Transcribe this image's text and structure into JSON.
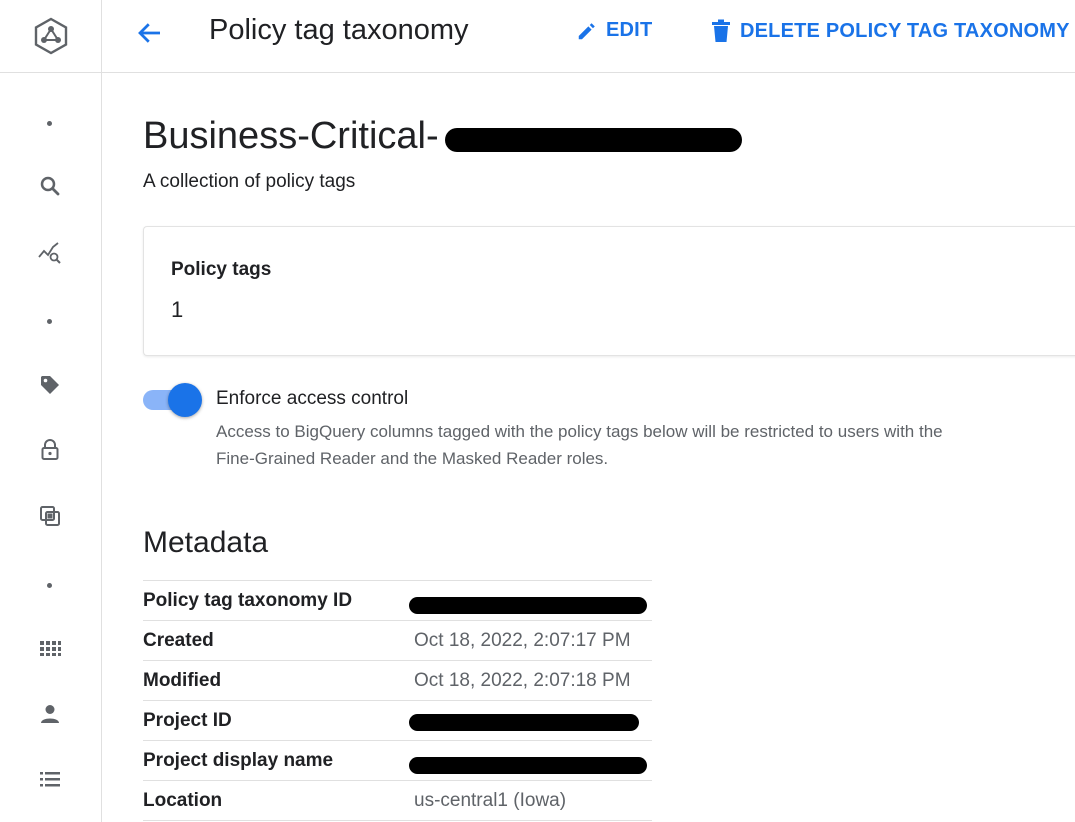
{
  "header": {
    "title": "Policy tag taxonomy",
    "edit_label": "EDIT",
    "delete_label": "DELETE POLICY TAG TAXONOMY"
  },
  "sidebar": {
    "items": [
      {
        "icon": "dot-icon"
      },
      {
        "icon": "search-icon"
      },
      {
        "icon": "insights-icon"
      },
      {
        "icon": "dot-icon"
      },
      {
        "icon": "tag-icon"
      },
      {
        "icon": "lock-icon"
      },
      {
        "icon": "filter-none-icon"
      },
      {
        "icon": "dot-icon"
      },
      {
        "icon": "apps-grid-icon"
      },
      {
        "icon": "person-icon"
      },
      {
        "icon": "list-icon"
      }
    ]
  },
  "taxonomy": {
    "name": "Business-Critical-",
    "description": "A collection of policy tags"
  },
  "policy_tags": {
    "label": "Policy tags",
    "count": "1"
  },
  "access_control": {
    "enabled": true,
    "title": "Enforce access control",
    "description": "Access to BigQuery columns tagged with the policy tags below will be restricted to users with the Fine-Grained Reader and the Masked Reader roles."
  },
  "metadata": {
    "title": "Metadata",
    "rows": [
      {
        "key": "Policy tag taxonomy ID",
        "value": ""
      },
      {
        "key": "Created",
        "value": "Oct 18, 2022, 2:07:17 PM"
      },
      {
        "key": "Modified",
        "value": "Oct 18, 2022, 2:07:18 PM"
      },
      {
        "key": "Project ID",
        "value": ""
      },
      {
        "key": "Project display name",
        "value": ""
      },
      {
        "key": "Location",
        "value": "us-central1 (Iowa)"
      }
    ]
  },
  "colors": {
    "accent": "#1a73e8",
    "toggle_track": "#8ab4f8",
    "secondary_text": "#5f6368"
  }
}
